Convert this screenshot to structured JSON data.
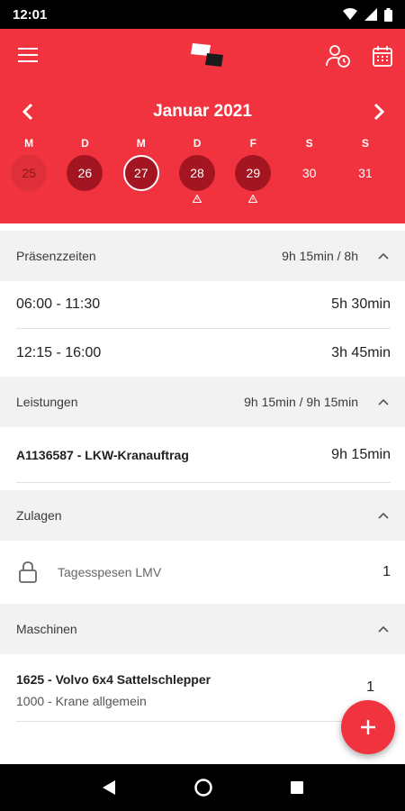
{
  "status_bar": {
    "time": "12:01",
    "icons": [
      "wifi-icon",
      "signal-icon",
      "battery-icon"
    ]
  },
  "header": {
    "icons": [
      "menu-icon",
      "app-logo",
      "user-clock-icon",
      "calendar-icon"
    ],
    "month_title": "Januar 2021",
    "days": [
      {
        "letter": "M",
        "date": "25",
        "state": "past",
        "warning": false
      },
      {
        "letter": "D",
        "date": "26",
        "state": "filled",
        "warning": false
      },
      {
        "letter": "M",
        "date": "27",
        "state": "selected",
        "warning": false
      },
      {
        "letter": "D",
        "date": "28",
        "state": "filled",
        "warning": true
      },
      {
        "letter": "F",
        "date": "29",
        "state": "filled",
        "warning": true
      },
      {
        "letter": "S",
        "date": "30",
        "state": "plain",
        "warning": false
      },
      {
        "letter": "S",
        "date": "31",
        "state": "plain",
        "warning": false
      }
    ]
  },
  "sections": {
    "praesenz": {
      "title": "Präsenzzeiten",
      "summary": "9h 15min / 8h",
      "rows": [
        {
          "range": "06:00 - 11:30",
          "duration": "5h 30min"
        },
        {
          "range": "12:15 - 16:00",
          "duration": "3h 45min"
        }
      ]
    },
    "leistungen": {
      "title": "Leistungen",
      "summary": "9h 15min / 9h 15min",
      "rows": [
        {
          "label": "A1136587 - LKW-Kranauftrag",
          "duration": "9h 15min"
        }
      ]
    },
    "zulagen": {
      "title": "Zulagen",
      "rows": [
        {
          "label": "Tagesspesen LMV",
          "count": "1"
        }
      ]
    },
    "maschinen": {
      "title": "Maschinen",
      "rows": [
        {
          "title": "1625 - Volvo 6x4 Sattelschlepper",
          "subtitle": "1000 - Krane allgemein",
          "count": "1"
        }
      ]
    }
  },
  "fab": {
    "icon": "plus-icon"
  },
  "nav_bar": {
    "icons": [
      "back-icon",
      "home-icon",
      "recents-icon"
    ]
  },
  "colors": {
    "primary": "#f1333f",
    "dark_day": "#a31520",
    "section_bg": "#f2f2f2"
  }
}
